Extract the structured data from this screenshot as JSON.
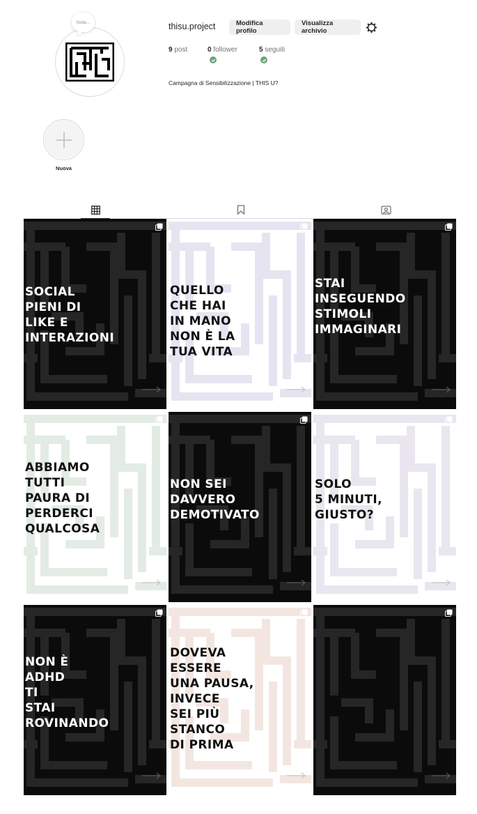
{
  "profile": {
    "note_label": "Nota...",
    "username": "thisu.project",
    "edit_button": "Modifica profilo",
    "archive_button": "Visualizza archivio",
    "bio": "Campagna di Sensibilizzazione | THIS U?",
    "stats": [
      {
        "count": "9",
        "label": "post"
      },
      {
        "count": "0",
        "label": "follower"
      },
      {
        "count": "5",
        "label": "seguiti"
      }
    ]
  },
  "highlights": {
    "new_label": "Nuova"
  },
  "tabs": [
    {
      "icon": "grid-icon",
      "active": true
    },
    {
      "icon": "bookmark-icon",
      "active": false
    },
    {
      "icon": "tagged-icon",
      "active": false
    }
  ],
  "colors": {
    "dark_bg": "#0b0b0b",
    "maze_dark": "#262626",
    "green_check": "#6aa57f"
  },
  "posts": [
    {
      "text": "SOCIAL\nPIENI DI\nLIKE E\nINTERAZIONI",
      "theme": "dark",
      "tint": "#f0f0f0",
      "multi": true
    },
    {
      "text": "QUELLO\nCHE HAI\nIN MANO\nNON È LA\nTUA VITA",
      "theme": "light",
      "tint": "#e6e4f0",
      "multi": true
    },
    {
      "text": "STAI\nINSEGUENDO\nSTIMOLI\nIMMAGINARI",
      "theme": "dark",
      "tint": "#f0f0f0",
      "multi": true
    },
    {
      "text": "ABBIAMO\nTUTTI\nPAURA DI\nPERDERCI\nQUALCOSA",
      "theme": "light",
      "tint": "#e3ece4",
      "multi": true
    },
    {
      "text": "NON SEI\nDAVVERO\nDEMOTIVATO",
      "theme": "dark",
      "tint": "#f0f0f0",
      "multi": true
    },
    {
      "text": "SOLO\n5 MINUTI,\nGIUSTO?",
      "theme": "light",
      "tint": "#e9e6ef",
      "multi": true
    },
    {
      "text": "NON È\nADHD\nTI\nSTAI\nROVINANDO",
      "theme": "dark",
      "tint": "#f0f0f0",
      "multi": true
    },
    {
      "text": "DOVEVA\nESSERE\nUNA PAUSA,\nINVECE\nSEI PIÙ\nSTANCO\nDI PRIMA",
      "theme": "light",
      "tint": "#f3e6e1",
      "multi": true
    },
    {
      "text": "",
      "theme": "dark",
      "tint": "#f0f0f0",
      "multi": true
    }
  ]
}
